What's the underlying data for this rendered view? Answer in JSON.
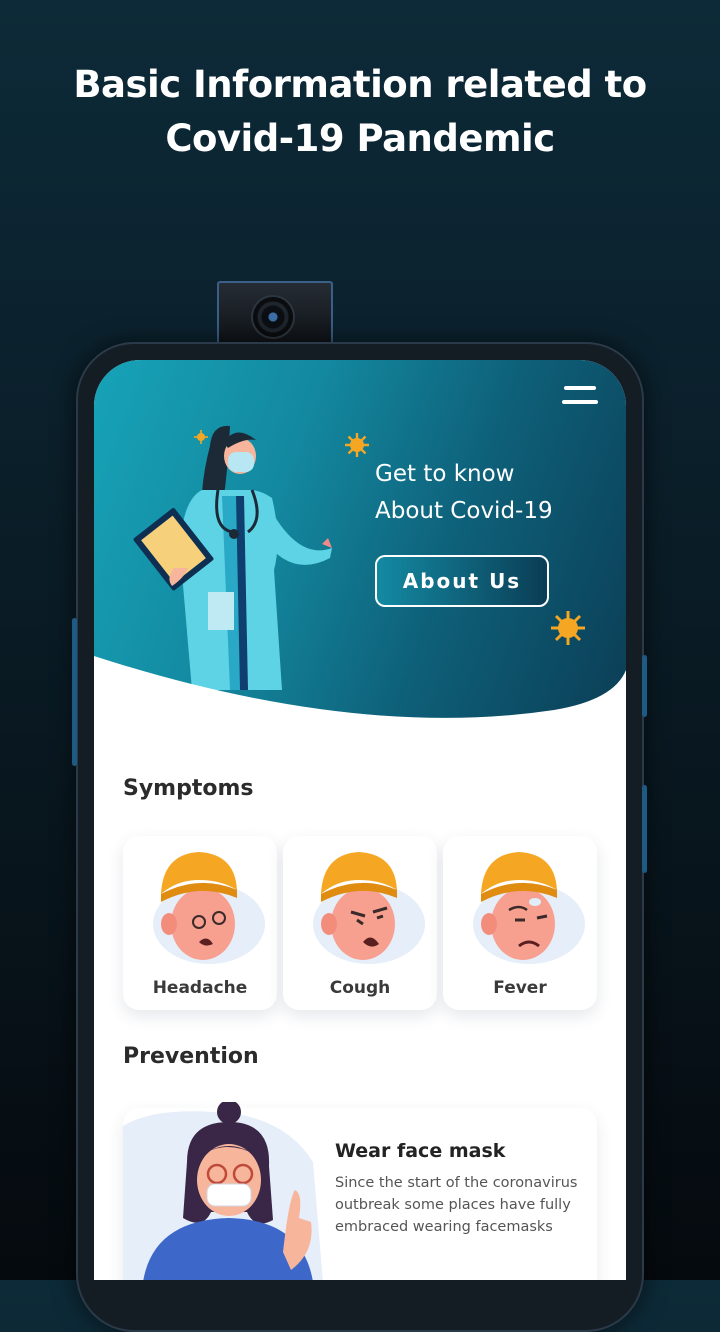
{
  "promo": {
    "title": "Basic Information related to\nCovid-19 Pandemic"
  },
  "hero": {
    "headline": "Get to know\nAbout Covid-19",
    "about_button": "About Us",
    "menu_icon": "hamburger-menu-icon"
  },
  "symptoms": {
    "title": "Symptoms",
    "items": [
      {
        "label": "Headache",
        "icon": "headache-face-icon"
      },
      {
        "label": "Cough",
        "icon": "cough-face-icon"
      },
      {
        "label": "Fever",
        "icon": "fever-face-icon"
      }
    ]
  },
  "prevention": {
    "title": "Prevention",
    "items": [
      {
        "title": "Wear face mask",
        "description": "Since the start of the coronavirus outbreak some places have fully embraced wearing facemasks",
        "icon": "woman-with-mask-illustration"
      }
    ]
  },
  "colors": {
    "hero_start": "#17a3b8",
    "hero_end": "#0b3d55",
    "virus": "#f5a623",
    "beanie": "#f5a623"
  }
}
